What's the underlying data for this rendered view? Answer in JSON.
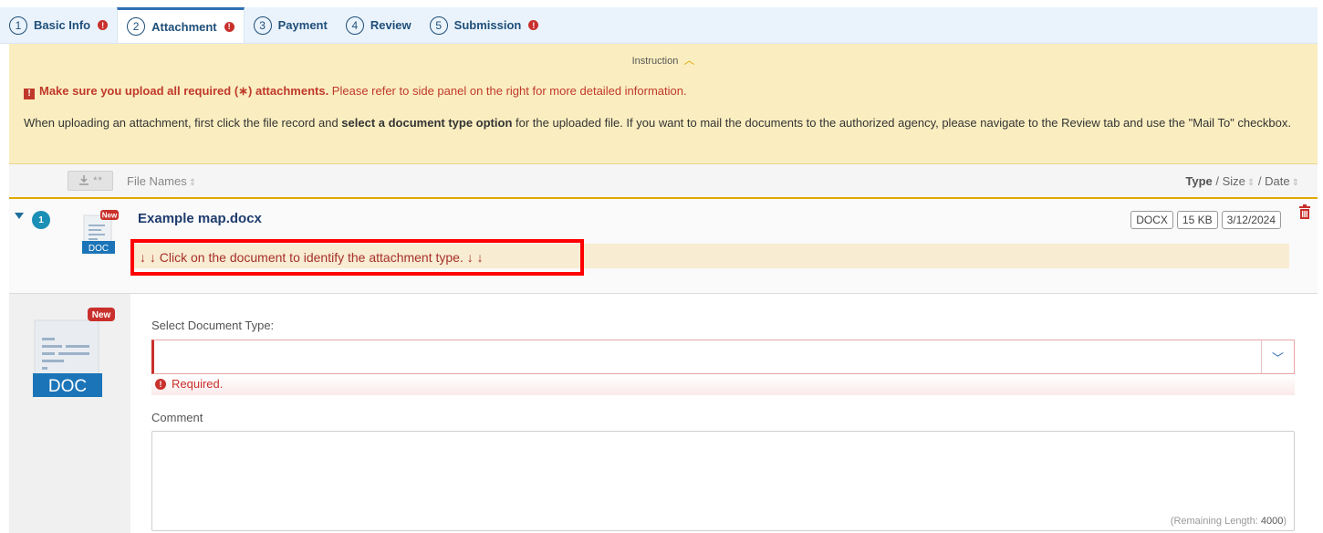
{
  "tabs": [
    {
      "num": "1",
      "label": "Basic Info",
      "error": true
    },
    {
      "num": "2",
      "label": "Attachment",
      "error": true,
      "active": true
    },
    {
      "num": "3",
      "label": "Payment",
      "error": false
    },
    {
      "num": "4",
      "label": "Review",
      "error": false
    },
    {
      "num": "5",
      "label": "Submission",
      "error": true
    }
  ],
  "instruction": {
    "header": "Instruction",
    "warning_bold": "Make sure you upload all required (∗) attachments.",
    "warning_rest": " Please refer to side panel on the right for more detailed information.",
    "body_part1": "When uploading an attachment, first click the file record and ",
    "body_bold": "select a document type option",
    "body_part2": " for the uploaded file. If you want to mail the documents to the authorized agency, please navigate to the Review tab and use the \"Mail To\" checkbox."
  },
  "list_header": {
    "file_names": "File Names",
    "type": "Type",
    "size": "Size",
    "date": "Date",
    "download_icon": "download-icon"
  },
  "file": {
    "index": "1",
    "name": "Example map.docx",
    "badge": "New",
    "doc_label": "DOC",
    "type": "DOCX",
    "size": "15 KB",
    "date": "3/12/2024",
    "hint": "↓ ↓ Click on the document to identify the attachment type. ↓ ↓"
  },
  "detail": {
    "badge": "New",
    "doc_label": "DOC",
    "select_label": "Select Document Type:",
    "select_value": "",
    "required_msg": "Required.",
    "comment_label": "Comment",
    "comment_value": "",
    "remaining_label": "(Remaining Length: ",
    "remaining_value": "4000",
    "remaining_close": ")"
  },
  "colors": {
    "tab_bg": "#eaf3fb",
    "instruction_bg": "#faeec0",
    "error": "#c9302c",
    "highlight_border": "#ff0000",
    "title": "#1f3c6e"
  }
}
